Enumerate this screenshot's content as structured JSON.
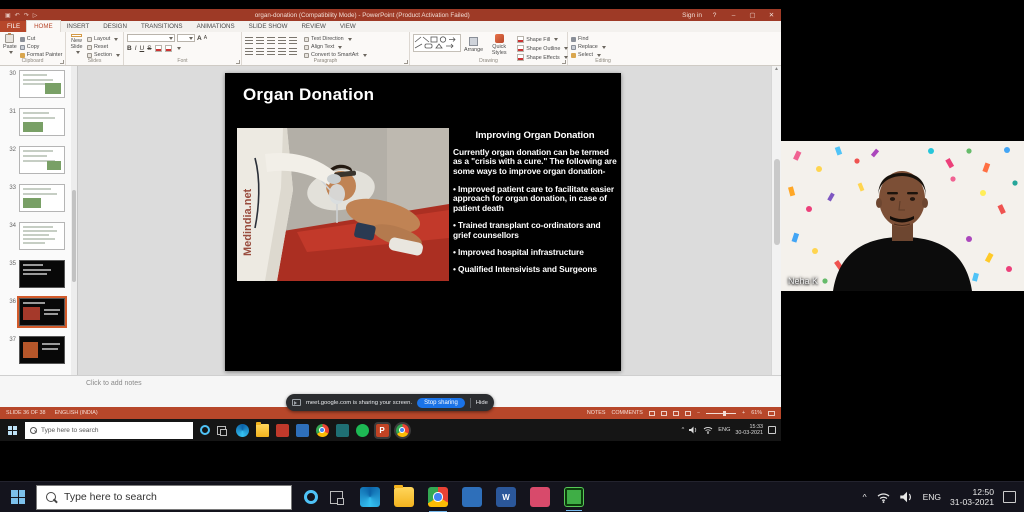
{
  "window": {
    "title": "organ-donation (Compatibility Mode) - PowerPoint (Product Activation Failed)",
    "sign_in": "Sign in"
  },
  "ribbon": {
    "tabs": [
      "FILE",
      "HOME",
      "INSERT",
      "DESIGN",
      "TRANSITIONS",
      "ANIMATIONS",
      "SLIDE SHOW",
      "REVIEW",
      "VIEW"
    ],
    "clipboard": {
      "label": "Clipboard",
      "paste": "Paste",
      "cut": "Cut",
      "copy": "Copy",
      "format_painter": "Format Painter"
    },
    "slides_group": {
      "label": "Slides",
      "new_slide": "New Slide",
      "layout": "Layout",
      "reset": "Reset",
      "section": "Section"
    },
    "font_group": {
      "label": "Font",
      "bold": "B",
      "italic": "I",
      "underline": "U",
      "strike": "S",
      "grow": "A",
      "shrink": "A"
    },
    "paragraph_group": {
      "label": "Paragraph",
      "text_direction": "Text Direction",
      "align_text": "Align Text",
      "smartart": "Convert to SmartArt"
    },
    "drawing_group": {
      "label": "Drawing",
      "arrange": "Arrange",
      "quick_styles": "Quick Styles",
      "shape_fill": "Shape Fill",
      "shape_outline": "Shape Outline",
      "shape_effects": "Shape Effects"
    },
    "editing_group": {
      "label": "Editing",
      "find": "Find",
      "replace": "Replace",
      "select": "Select"
    }
  },
  "thumbnails": [
    "30",
    "31",
    "32",
    "33",
    "34",
    "35",
    "36",
    "37"
  ],
  "slide": {
    "title": "Organ Donation",
    "heading": "Improving Organ Donation",
    "intro": "Currently organ donation can be termed as a \"crisis with a cure.\" The following are some ways to improve organ donation-",
    "bullets": [
      "• Improved patient care to facilitate easier approach for organ donation, in case of patient death",
      "• Trained transplant co-ordinators and grief counsellors",
      "• Improved hospital infrastructure",
      "• Qualified Intensivists and Surgeons"
    ],
    "watermark": "Medindia.net"
  },
  "notes_placeholder": "Click to add notes",
  "meet_bar": {
    "message": "meet.google.com is sharing your screen.",
    "stop_button": "Stop sharing",
    "hide": "Hide"
  },
  "status_bar": {
    "slide_indicator": "SLIDE 36 OF 38",
    "language": "ENGLISH (INDIA)",
    "notes": "NOTES",
    "comments": "COMMENTS",
    "zoom": "61%"
  },
  "inner_taskbar": {
    "search_placeholder": "Type here to search",
    "lang": "ENG",
    "time": "15:33",
    "date": "30-03-2021"
  },
  "outer_taskbar": {
    "search_placeholder": "Type here to search",
    "lang": "ENG",
    "time": "12:50",
    "date": "31-03-2021"
  },
  "webcam": {
    "label": "Neha K"
  },
  "icons": {
    "minimize": "–",
    "maximize": "▢",
    "close": "✕",
    "help": "?",
    "dropdown": "▾",
    "chevron_up": "^",
    "scroll_up": "▲",
    "scroll_down": "▼",
    "minus": "−",
    "plus": "+",
    "word_letter": "W",
    "ppt_letter": "P"
  }
}
